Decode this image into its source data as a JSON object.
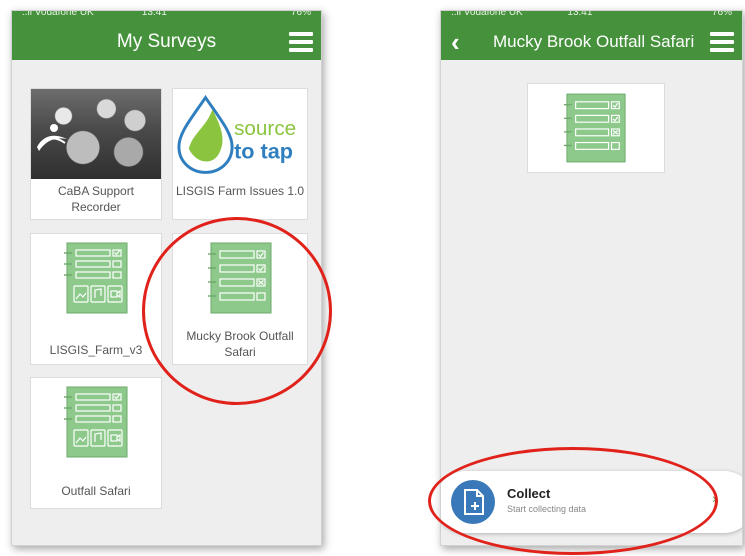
{
  "left_phone": {
    "statusbar": {
      "carrier": "..il Vodafone UK",
      "time": "13:41",
      "battery": "76%"
    },
    "title": "My Surveys",
    "surveys": [
      {
        "name": "CaBA Support Recorder",
        "thumb": "photo"
      },
      {
        "name": "LISGIS Farm Issues 1.0",
        "thumb": "source-to-tap-logo"
      },
      {
        "name": "LISGIS_Farm_v3",
        "thumb": "form-media-icon"
      },
      {
        "name": "Mucky Brook Outfall Safari",
        "thumb": "form-icon"
      },
      {
        "name": "Outfall Safari",
        "thumb": "form-media-icon"
      }
    ],
    "logo_text": {
      "line1": "source",
      "line2": "to tap"
    }
  },
  "right_phone": {
    "statusbar": {
      "carrier": "..il Vodafone UK",
      "time": "13:41",
      "battery": "76%"
    },
    "title": "Mucky Brook Outfall Safari",
    "collect": {
      "title": "Collect",
      "subtitle": "Start collecting data"
    }
  },
  "colors": {
    "header": "#46923c",
    "form_green": "#8cc98a",
    "collect_blue": "#3a79b9",
    "highlight": "#e0221b"
  }
}
